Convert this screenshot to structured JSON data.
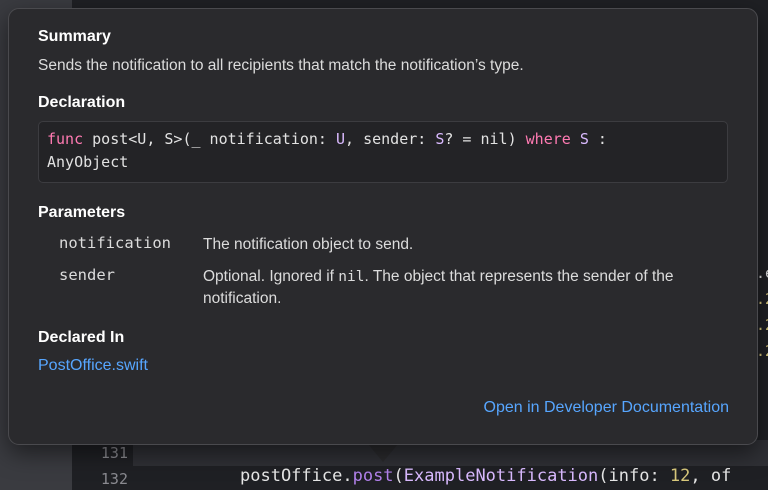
{
  "popover": {
    "summary_title": "Summary",
    "summary_text": "Sends the notification to all recipients that match the notification’s type.",
    "declaration_title": "Declaration",
    "declaration": {
      "line1_kw": "func",
      "line1_a": " post<U, S>(_ notification: ",
      "line1_u": "U",
      "line1_b": ", sender: ",
      "line1_s": "S",
      "line1_c": "? = nil) ",
      "line1_where": "where",
      "line1_d": " ",
      "line1_s2": "S",
      "line1_e": " :",
      "line2": "AnyObject"
    },
    "parameters_title": "Parameters",
    "parameters": [
      {
        "name": "notification",
        "description": "The notification object to send."
      },
      {
        "name": "sender",
        "desc_prefix": "Optional. Ignored if ",
        "desc_code": "nil",
        "desc_suffix": ". The object that represents the sender of the notification."
      }
    ],
    "declared_in_title": "Declared In",
    "declared_in_file": "PostOffice.swift",
    "open_docs_link": "Open in Developer Documentation"
  },
  "editor": {
    "line_numbers": [
      "131",
      "132"
    ],
    "code_line": {
      "a": "postOffice.",
      "method": "post",
      "b": "(",
      "type": "ExampleNotification",
      "c": "(info: ",
      "num": "12",
      "d": ", of"
    },
    "peek_right": [
      ".e",
      ".2",
      ".2",
      ".2"
    ]
  }
}
